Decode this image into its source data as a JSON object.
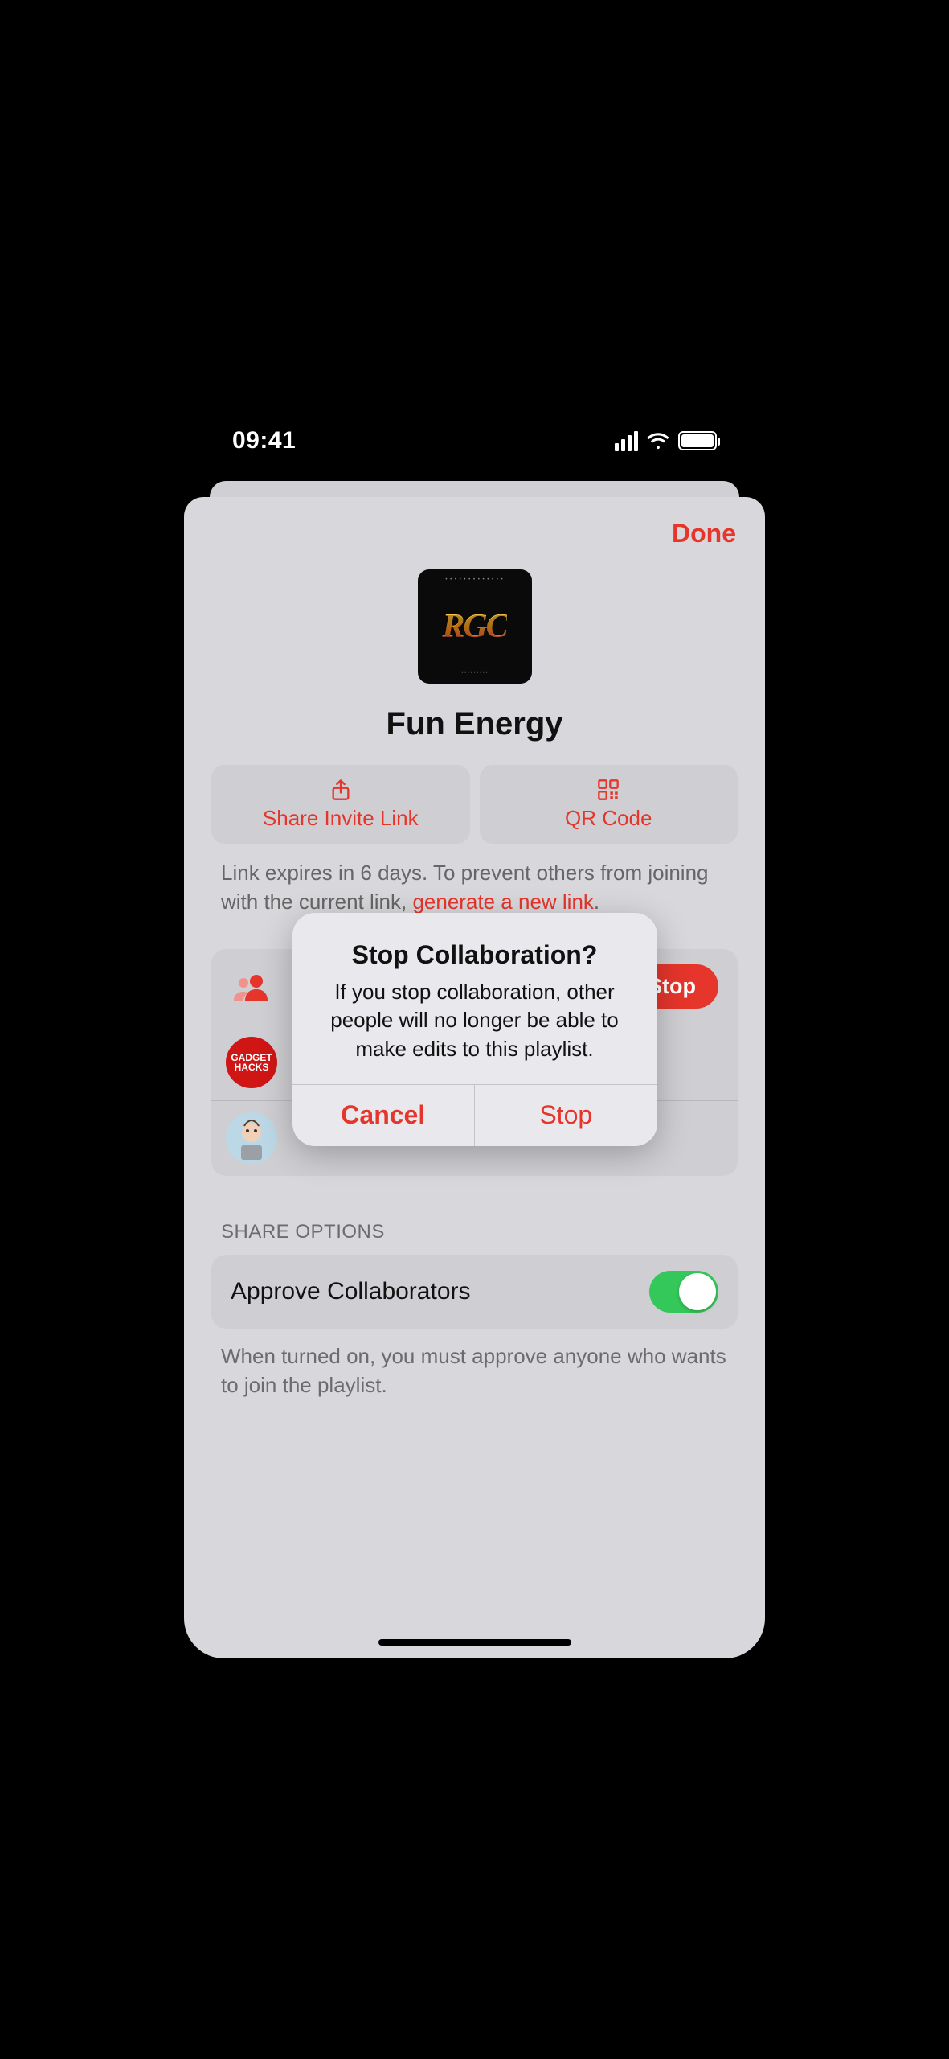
{
  "status": {
    "time": "09:41"
  },
  "header": {
    "done": "Done"
  },
  "artwork": {
    "logo": "RGC"
  },
  "playlist": {
    "title": "Fun Energy"
  },
  "buttons": {
    "share_link": "Share Invite Link",
    "qr_code": "QR Code"
  },
  "expire": {
    "prefix": "Link expires in 6 days. To prevent others from joining with the current link, ",
    "link": "generate a new link",
    "suffix": "."
  },
  "collab": {
    "stop_btn": "Stop",
    "avatar1_line1": "GADGET",
    "avatar1_line2": "HACKS"
  },
  "share_options": {
    "header": "SHARE OPTIONS",
    "approve_label": "Approve Collaborators",
    "approve_on": true,
    "hint": "When turned on, you must approve anyone who wants to join the playlist."
  },
  "alert": {
    "title": "Stop Collaboration?",
    "message": "If you stop collaboration, other people will no longer be able to make edits to this playlist.",
    "cancel": "Cancel",
    "stop": "Stop"
  }
}
